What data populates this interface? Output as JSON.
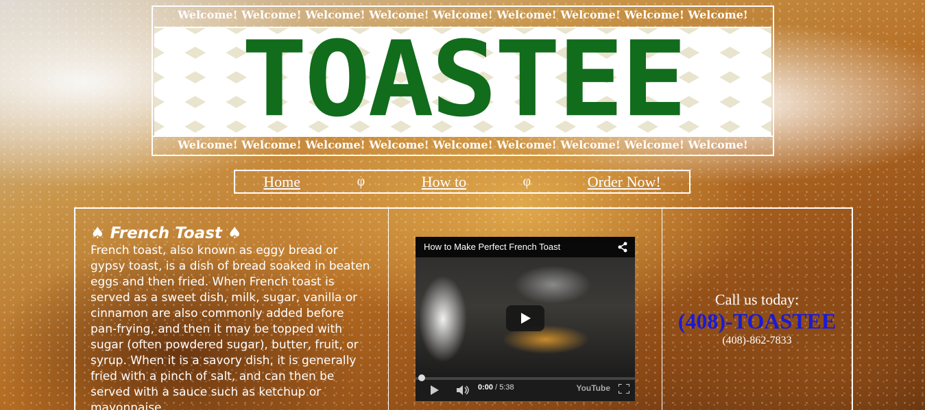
{
  "header": {
    "welcome_top": "Welcome! Welcome! Welcome! Welcome! Welcome! Welcome! Welcome! Welcome! Welcome!",
    "logo_text": "TOASTEE",
    "welcome_bottom": "Welcome! Welcome! Welcome! Welcome! Welcome! Welcome! Welcome! Welcome! Welcome!"
  },
  "nav": {
    "home": "Home",
    "sep1": "φ",
    "howto": "How to",
    "sep2": "φ",
    "order": "Order Now!"
  },
  "article": {
    "title": "♠ French Toast ♠",
    "body": "French toast, also known as eggy bread or gypsy toast, is a dish of bread soaked in beaten eggs and then fried. When French toast is served as a sweet dish, milk, sugar, vanilla or cinnamon are also commonly added before pan-frying, and then it may be topped with sugar (often powdered sugar), butter, fruit, or syrup. When it is a savory dish, it is generally fried with a pinch of salt, and can then be served with a sauce such as ketchup or mayonnaise."
  },
  "video": {
    "title": "How to Make Perfect French Toast",
    "time_current": "0:00",
    "time_total": "/ 5:38",
    "brand": "YouTube",
    "progress_fraction": 0
  },
  "contact": {
    "label": "Call us today:",
    "vanity": "(408)-TOASTEE",
    "number": "(408)-862-7833"
  },
  "colors": {
    "logo_green": "#116c1c",
    "vanity_blue": "#1a1ad6",
    "border": "#ffffff"
  }
}
